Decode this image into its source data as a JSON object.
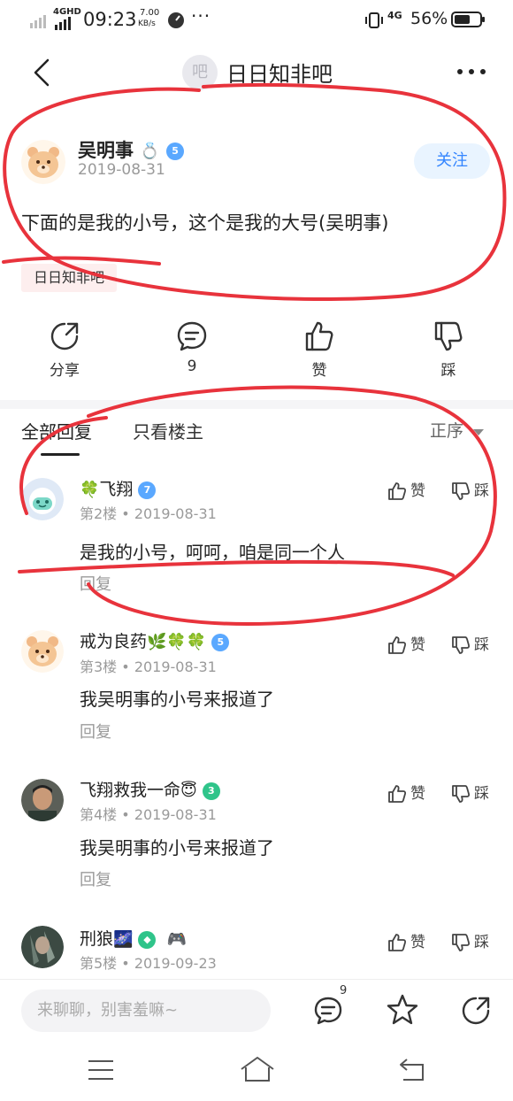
{
  "status_bar": {
    "network": "4GHD",
    "time": "09:23",
    "speed_value": "7.00",
    "speed_unit": "KB/s",
    "signal2": "4G",
    "battery": "56%"
  },
  "nav": {
    "title_icon_text": "吧",
    "title": "日日知非吧"
  },
  "post": {
    "author": "吴明事",
    "level": "5",
    "date": "2019-08-31",
    "follow_label": "关注",
    "content": "下面的是我的小号，这个是我的大号(吴明事)",
    "forum_tag": "日日知非吧",
    "actions": {
      "share": "分享",
      "comment_count": "9",
      "like": "赞",
      "dislike": "踩"
    }
  },
  "tabs": {
    "all": "全部回复",
    "owner_only": "只看楼主",
    "sort": "正序"
  },
  "comments": [
    {
      "name": "飞翔",
      "name_emoji": "🍀",
      "level": "7",
      "floor": "第2楼",
      "date": "2019-08-31",
      "text": "是我的小号，呵呵，咱是同一个人",
      "reply": "回复",
      "like": "赞",
      "dislike": "踩"
    },
    {
      "name": "戒为良药",
      "name_emoji": "🌿🍀🍀",
      "level": "5",
      "floor": "第3楼",
      "date": "2019-08-31",
      "text": "我吴明事的小号来报道了",
      "reply": "回复",
      "like": "赞",
      "dislike": "踩"
    },
    {
      "name": "飞翔救我一命",
      "name_emoji": "😇",
      "level": "3",
      "floor": "第4楼",
      "date": "2019-08-31",
      "text": "我吴明事的小号来报道了",
      "reply": "回复",
      "like": "赞",
      "dislike": "踩"
    },
    {
      "name": "刑狼",
      "name_emoji": "🌌",
      "level": "",
      "floor": "第5楼",
      "date": "2019-09-23",
      "extra_emoji": "🎮",
      "like": "赞",
      "dislike": "踩"
    }
  ],
  "bottom": {
    "input_placeholder": "来聊聊，别害羞嘛~",
    "comment_badge": "9"
  },
  "colors": {
    "accent_blue": "#3385ff",
    "annotation_red": "#e8333c",
    "level_badge_blue": "#5aa8ff",
    "level_badge_teal": "#2fc48a"
  },
  "icons": {
    "back": "back-arrow-icon",
    "more": "more-dots-icon",
    "share": "share-icon",
    "comment": "comment-icon",
    "like": "thumbs-up-icon",
    "dislike": "thumbs-down-icon",
    "star": "star-icon",
    "menu": "menu-icon",
    "home": "home-icon",
    "return": "return-icon"
  }
}
